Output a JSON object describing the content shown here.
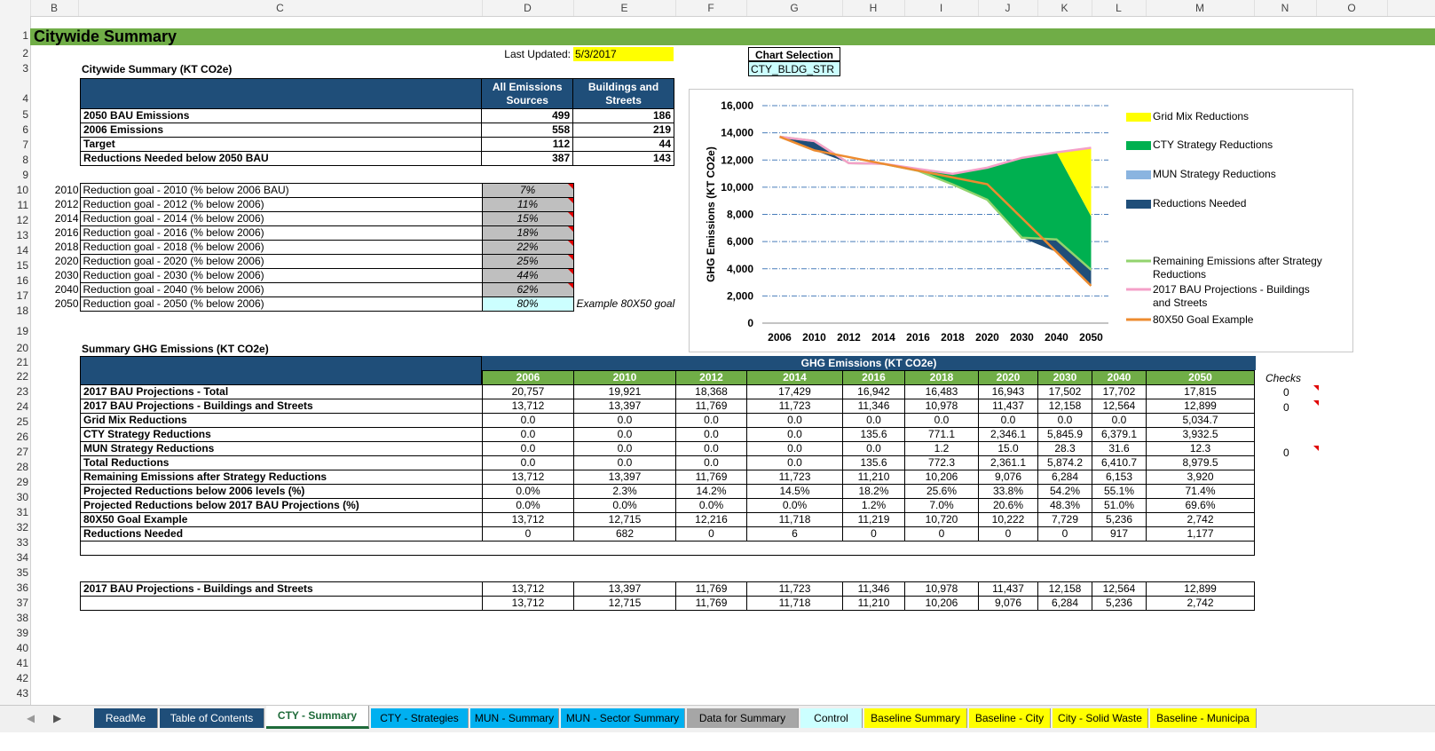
{
  "sheet_title": "Citywide Summary",
  "columns": [
    "B",
    "C",
    "D",
    "E",
    "F",
    "G",
    "H",
    "I",
    "J",
    "K",
    "L",
    "M",
    "N",
    "O"
  ],
  "rows": [
    "1",
    "2",
    "3",
    "4",
    "5",
    "6",
    "7",
    "8",
    "9",
    "10",
    "11",
    "12",
    "13",
    "14",
    "15",
    "16",
    "17",
    "18",
    "19",
    "20",
    "21",
    "22",
    "23",
    "24",
    "25",
    "26",
    "27",
    "28",
    "29",
    "30",
    "31",
    "32",
    "33",
    "34",
    "35",
    "36",
    "37",
    "38",
    "39",
    "40",
    "41",
    "42",
    "43"
  ],
  "last_updated_label": "Last Updated:",
  "last_updated_value": "5/3/2017",
  "chart_selection_label": "Chart Selection",
  "chart_selection_value": "CTY_BLDG_STR",
  "summary1": {
    "title": "Citywide Summary (KT CO2e)",
    "col_all": "All Emissions Sources",
    "col_bld": "Buildings and Streets",
    "rows": [
      {
        "label": "2050 BAU Emissions",
        "all": "499",
        "bld": "186"
      },
      {
        "label": "2006 Emissions",
        "all": "558",
        "bld": "219"
      },
      {
        "label": "Target",
        "all": "112",
        "bld": "44"
      },
      {
        "label": "Reductions Needed below 2050 BAU",
        "all": "387",
        "bld": "143"
      }
    ]
  },
  "goals": [
    {
      "year": "2010",
      "label": "Reduction goal - 2010 (% below 2006 BAU)",
      "value": "7%"
    },
    {
      "year": "2012",
      "label": "Reduction goal - 2012 (% below 2006)",
      "value": "11%"
    },
    {
      "year": "2014",
      "label": "Reduction goal - 2014 (% below 2006)",
      "value": "15%"
    },
    {
      "year": "2016",
      "label": "Reduction goal - 2016 (% below 2006)",
      "value": "18%"
    },
    {
      "year": "2018",
      "label": "Reduction goal - 2018 (% below 2006)",
      "value": "22%"
    },
    {
      "year": "2020",
      "label": "Reduction goal - 2020 (% below 2006)",
      "value": "25%"
    },
    {
      "year": "2030",
      "label": "Reduction goal - 2030 (% below 2006)",
      "value": "44%"
    },
    {
      "year": "2040",
      "label": "Reduction goal - 2040 (% below 2006)",
      "value": "62%"
    },
    {
      "year": "2050",
      "label": "Reduction goal - 2050 (% below 2006)",
      "value": "80%"
    }
  ],
  "goal_note": "Example 80X50 goal",
  "summary2": {
    "title": "Summary GHG Emissions (KT CO2e)",
    "group_header": "GHG Emissions (KT CO2e)",
    "years": [
      "2006",
      "2010",
      "2012",
      "2014",
      "2016",
      "2018",
      "2020",
      "2030",
      "2040",
      "2050"
    ],
    "checks_label": "Checks",
    "rows": [
      {
        "label": "2017 BAU Projections - Total",
        "values": [
          "20,757",
          "19,921",
          "18,368",
          "17,429",
          "16,942",
          "16,483",
          "16,943",
          "17,502",
          "17,702",
          "17,815"
        ],
        "check": "0"
      },
      {
        "label": "2017 BAU Projections - Buildings and Streets",
        "values": [
          "13,712",
          "13,397",
          "11,769",
          "11,723",
          "11,346",
          "10,978",
          "11,437",
          "12,158",
          "12,564",
          "12,899"
        ],
        "check": "0"
      },
      {
        "label": "Grid Mix Reductions",
        "values": [
          "0.0",
          "0.0",
          "0.0",
          "0.0",
          "0.0",
          "0.0",
          "0.0",
          "0.0",
          "0.0",
          "5,034.7"
        ],
        "check": ""
      },
      {
        "label": "CTY Strategy Reductions",
        "values": [
          "0.0",
          "0.0",
          "0.0",
          "0.0",
          "135.6",
          "771.1",
          "2,346.1",
          "5,845.9",
          "6,379.1",
          "3,932.5"
        ],
        "check": ""
      },
      {
        "label": "MUN Strategy Reductions",
        "values": [
          "0.0",
          "0.0",
          "0.0",
          "0.0",
          "0.0",
          "1.2",
          "15.0",
          "28.3",
          "31.6",
          "12.3"
        ],
        "check": "0"
      },
      {
        "label": "Total Reductions",
        "values": [
          "0.0",
          "0.0",
          "0.0",
          "0.0",
          "135.6",
          "772.3",
          "2,361.1",
          "5,874.2",
          "6,410.7",
          "8,979.5"
        ],
        "check": ""
      },
      {
        "label": "Remaining Emissions after Strategy Reductions",
        "values": [
          "13,712",
          "13,397",
          "11,769",
          "11,723",
          "11,210",
          "10,206",
          "9,076",
          "6,284",
          "6,153",
          "3,920"
        ],
        "check": ""
      },
      {
        "label": "Projected Reductions below 2006 levels (%)",
        "values": [
          "0.0%",
          "2.3%",
          "14.2%",
          "14.5%",
          "18.2%",
          "25.6%",
          "33.8%",
          "54.2%",
          "55.1%",
          "71.4%"
        ],
        "check": ""
      },
      {
        "label": "Projected Reductions below 2017 BAU Projections (%)",
        "values": [
          "0.0%",
          "0.0%",
          "0.0%",
          "0.0%",
          "1.2%",
          "7.0%",
          "20.6%",
          "48.3%",
          "51.0%",
          "69.6%"
        ],
        "check": ""
      },
      {
        "label": "80X50 Goal Example",
        "values": [
          "13,712",
          "12,715",
          "12,216",
          "11,718",
          "11,219",
          "10,720",
          "10,222",
          "7,729",
          "5,236",
          "2,742"
        ],
        "check": ""
      },
      {
        "label": "Reductions Needed",
        "values": [
          "0",
          "682",
          "0",
          "6",
          "0",
          "0",
          "0",
          "0",
          "917",
          "1,177"
        ],
        "check": ""
      }
    ],
    "bottom_rows": [
      {
        "label": "2017 BAU Projections - Buildings and Streets",
        "values": [
          "13,712",
          "13,397",
          "11,769",
          "11,723",
          "11,346",
          "10,978",
          "11,437",
          "12,158",
          "12,564",
          "12,899"
        ]
      },
      {
        "label": "",
        "values": [
          "13,712",
          "12,715",
          "11,769",
          "11,718",
          "11,210",
          "10,206",
          "9,076",
          "6,284",
          "5,236",
          "2,742"
        ]
      }
    ]
  },
  "chart_data": {
    "type": "area",
    "categories": [
      "2006",
      "2010",
      "2012",
      "2014",
      "2016",
      "2018",
      "2020",
      "2030",
      "2040",
      "2050"
    ],
    "ylabel": "GHG Emissions (KT CO2e)",
    "ylim": [
      0,
      16000
    ],
    "yticks": [
      "0",
      "2,000",
      "4,000",
      "6,000",
      "8,000",
      "10,000",
      "12,000",
      "14,000",
      "16,000"
    ],
    "grid": true,
    "legend_position": "right",
    "series": [
      {
        "name": "Grid Mix Reductions",
        "kind": "area",
        "color": "#ffff00",
        "values": [
          0,
          0,
          0,
          0,
          0,
          0,
          0,
          0,
          0,
          5034.7
        ]
      },
      {
        "name": "CTY Strategy Reductions",
        "kind": "area",
        "color": "#00b050",
        "values": [
          0,
          0,
          0,
          0,
          135.6,
          771.1,
          2346.1,
          5845.9,
          6379.1,
          3932.5
        ]
      },
      {
        "name": "MUN Strategy Reductions",
        "kind": "area",
        "color": "#8ab4e0",
        "values": [
          0,
          0,
          0,
          0,
          0,
          1.2,
          15.0,
          28.3,
          31.6,
          12.3
        ]
      },
      {
        "name": "Reductions Needed",
        "kind": "area",
        "color": "#1f4e79",
        "values": [
          0,
          682,
          0,
          6,
          0,
          0,
          0,
          0,
          917,
          1177
        ]
      },
      {
        "name": "Remaining Emissions after Strategy Reductions",
        "kind": "line",
        "color": "#92d36e",
        "values": [
          13712,
          13397,
          11769,
          11723,
          11210,
          10206,
          9076,
          6284,
          6153,
          3920
        ]
      },
      {
        "name": "2017 BAU Projections - Buildings and Streets",
        "kind": "line",
        "color": "#f4a0c8",
        "values": [
          13712,
          13397,
          11769,
          11723,
          11346,
          10978,
          11437,
          12158,
          12564,
          12899
        ]
      },
      {
        "name": "80X50 Goal Example",
        "kind": "line",
        "color": "#ed8b2f",
        "values": [
          13712,
          12715,
          12216,
          11718,
          11219,
          10720,
          10222,
          7729,
          5236,
          2742
        ]
      }
    ]
  },
  "tabs": [
    {
      "label": "ReadMe",
      "bg": "#1f4e79",
      "fg": "#ffffff"
    },
    {
      "label": "Table of Contents",
      "bg": "#1f4e79",
      "fg": "#ffffff"
    },
    {
      "label": "CTY - Summary",
      "bg": "#ffffff",
      "fg": "#1f6b3a",
      "active": true
    },
    {
      "label": "CTY - Strategies",
      "bg": "#00b0f0",
      "fg": "#000000"
    },
    {
      "label": "MUN - Summary",
      "bg": "#00b0f0",
      "fg": "#000000"
    },
    {
      "label": "MUN - Sector Summary",
      "bg": "#00b0f0",
      "fg": "#000000"
    },
    {
      "label": "Data for Summary",
      "bg": "#a6a6a6",
      "fg": "#000000"
    },
    {
      "label": "Control",
      "bg": "#ccffff",
      "fg": "#000000"
    },
    {
      "label": "Baseline Summary",
      "bg": "#ffff00",
      "fg": "#000000"
    },
    {
      "label": "Baseline - City",
      "bg": "#ffff00",
      "fg": "#000000"
    },
    {
      "label": "City - Solid Waste",
      "bg": "#ffff00",
      "fg": "#000000"
    },
    {
      "label": "Baseline - Municipa",
      "bg": "#ffff00",
      "fg": "#000000"
    }
  ]
}
